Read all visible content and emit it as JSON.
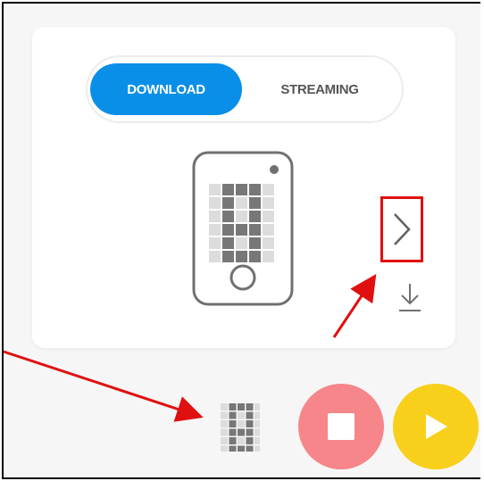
{
  "mode_toggle": {
    "download_label": "DOWNLOAD",
    "streaming_label": "STREAMING",
    "selected": "DOWNLOAD"
  },
  "icons": {
    "device": "phone-device-icon",
    "next": "chevron-right-icon",
    "download": "download-icon",
    "grid": "led-grid-icon",
    "stop": "stop-icon",
    "play": "play-icon"
  },
  "colors": {
    "accent_blue": "#0a8fe8",
    "stop_red": "#f6868a",
    "play_yellow": "#f8d01c",
    "annotation_red": "#e01010"
  }
}
